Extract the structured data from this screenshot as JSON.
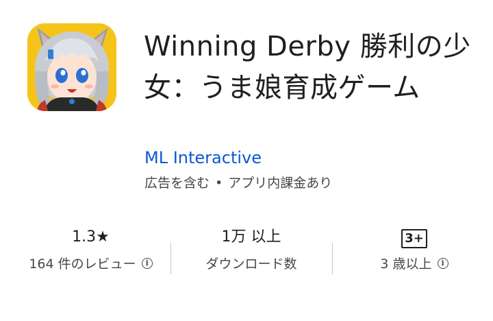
{
  "app": {
    "title": "Winning Derby 勝利の少女：うま娘育成ゲーム",
    "developer": "ML Interactive",
    "notes": [
      "広告を含む",
      "アプリ内課金あり"
    ],
    "notes_separator": "•"
  },
  "stats": {
    "rating": {
      "value": "1.3★",
      "label": "164 件のレビュー"
    },
    "downloads": {
      "value": "1万 以上",
      "label": "ダウンロード数"
    },
    "age": {
      "badge": "3+",
      "label": "3 歳以上"
    }
  },
  "icons": {
    "app_icon": "anime-horse-girl-app-icon",
    "info": "info-circle-icon",
    "rating_star": "star-icon"
  },
  "colors": {
    "developer_link": "#0b57d0",
    "text_primary": "#1f1f1f",
    "text_secondary": "#444746",
    "icon_background": "#f6c419"
  }
}
